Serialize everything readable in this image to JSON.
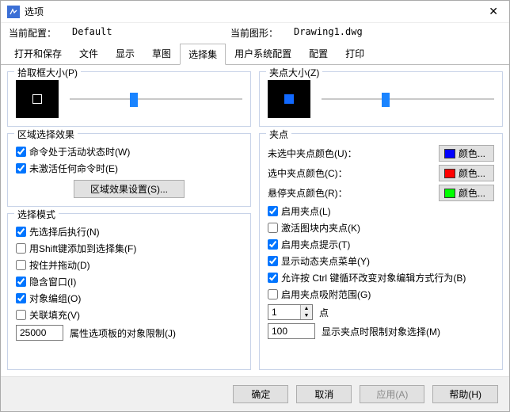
{
  "window": {
    "title": "选项"
  },
  "info": {
    "config_label": "当前配置：",
    "config_value": "Default",
    "drawing_label": "当前图形：",
    "drawing_value": "Drawing1.dwg"
  },
  "tabs": [
    "打开和保存",
    "文件",
    "显示",
    "草图",
    "选择集",
    "用户系统配置",
    "配置",
    "打印"
  ],
  "active_tab": "选择集",
  "pickbox": {
    "legend": "拾取框大小(P)"
  },
  "region": {
    "legend": "区域选择效果",
    "chk_active": "命令处于活动状态时(W)",
    "chk_inactive": "未激活任何命令时(E)",
    "settings_btn": "区域效果设置(S)..."
  },
  "selectmode": {
    "legend": "选择模式",
    "chk_preexec": "先选择后执行(N)",
    "chk_shift": "用Shift键添加到选择集(F)",
    "chk_pressdrag": "按住并拖动(D)",
    "chk_implied": "隐含窗口(I)",
    "chk_objgroup": "对象编组(O)",
    "chk_hatch": "关联填充(V)",
    "limit_value": "25000",
    "limit_label": "属性选项板的对象限制(J)"
  },
  "gripsize": {
    "legend": "夹点大小(Z)"
  },
  "grips": {
    "legend": "夹点",
    "unselected_label": "未选中夹点颜色(U)：",
    "selected_label": "选中夹点颜色(C)：",
    "hover_label": "悬停夹点颜色(R)：",
    "color_btn": "颜色...",
    "colors": {
      "unselected": "#0000ff",
      "selected": "#ff0000",
      "hover": "#00ff00"
    },
    "chk_enable": "启用夹点(L)",
    "chk_blocks": "激活图块内夹点(K)",
    "chk_tips": "启用夹点提示(T)",
    "chk_dynmenu": "显示动态夹点菜单(Y)",
    "chk_ctrlcycle": "允许按 Ctrl 键循环改变对象编辑方式行为(B)",
    "chk_snaprange": "启用夹点吸附范围(G)",
    "spin_value": "1",
    "spin_unit": "点",
    "limit_value": "100",
    "limit_label": "显示夹点时限制对象选择(M)"
  },
  "footer": {
    "ok": "确定",
    "cancel": "取消",
    "apply": "应用(A)",
    "help": "帮助(H)"
  }
}
